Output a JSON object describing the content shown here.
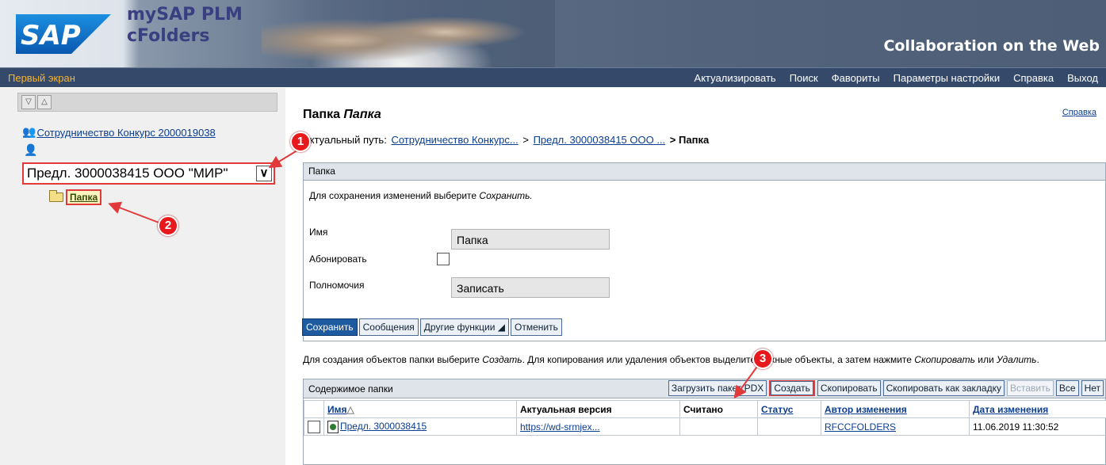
{
  "header": {
    "logo": "SAP",
    "app_title": "mySAP PLM",
    "app_subtitle": "cFolders",
    "tagline": "Collaboration on the Web"
  },
  "nav": {
    "home": "Первый экран",
    "items": [
      "Актуализировать",
      "Поиск",
      "Фавориты",
      "Параметры настройки",
      "Справка",
      "Выход"
    ]
  },
  "sidebar": {
    "collaboration_link": "Сотрудничество Конкурс 2000019038",
    "proposal_label": "Предл. 3000038415 ООО \"МИР\"",
    "folder_label": "Папка"
  },
  "annotations": [
    "1",
    "2",
    "3"
  ],
  "colors": {
    "annotation": "#e23a3a",
    "navbar": "#354a6a",
    "home_link": "#f4b331"
  },
  "page": {
    "title_prefix": "Папка",
    "title_name": "Папка",
    "help": "Справка",
    "path_label": "Актуальный путь:",
    "path": [
      "Сотрудничество Конкурс...",
      ">",
      "Предл. 3000038415 ООО ...",
      ">",
      "Папка"
    ]
  },
  "panel": {
    "header": "Папка",
    "hint_prefix": "Для сохранения изменений выберите",
    "hint_action": "Сохранить.",
    "fields": [
      {
        "label": "Имя",
        "value": "Папка"
      },
      {
        "label": "Абонировать",
        "value": ""
      },
      {
        "label": "Полномочия",
        "value": "Записать"
      }
    ],
    "buttons": [
      "Сохранить",
      "Сообщения",
      "Другие функции ◢",
      "Отменить"
    ]
  },
  "create_hint": {
    "part1": "Для создания объектов папки выберите",
    "create": "Создать",
    "part2": ". Для копирования или удаления объектов выделите нужные объекты, а затем нажмите",
    "copy": "Скопировать",
    "part3": "или",
    "delete": "Удалить",
    "end": "."
  },
  "contents": {
    "title": "Содержимое папки",
    "buttons": [
      "Загрузить пакет PDX",
      "Создать",
      "Скопировать",
      "Скопировать как закладку",
      "Вставить",
      "Все",
      "Нет"
    ],
    "columns": [
      "Имя",
      "Актуальная версия",
      "Считано",
      "Статус",
      "Автор изменения",
      "Дата изменения"
    ],
    "rows": [
      {
        "name": "Предл. 3000038415",
        "version": "https://wd-srmjex...",
        "read": "",
        "status": "",
        "author": "RFCCFOLDERS",
        "date": "11.06.2019 11:30:52"
      }
    ]
  }
}
